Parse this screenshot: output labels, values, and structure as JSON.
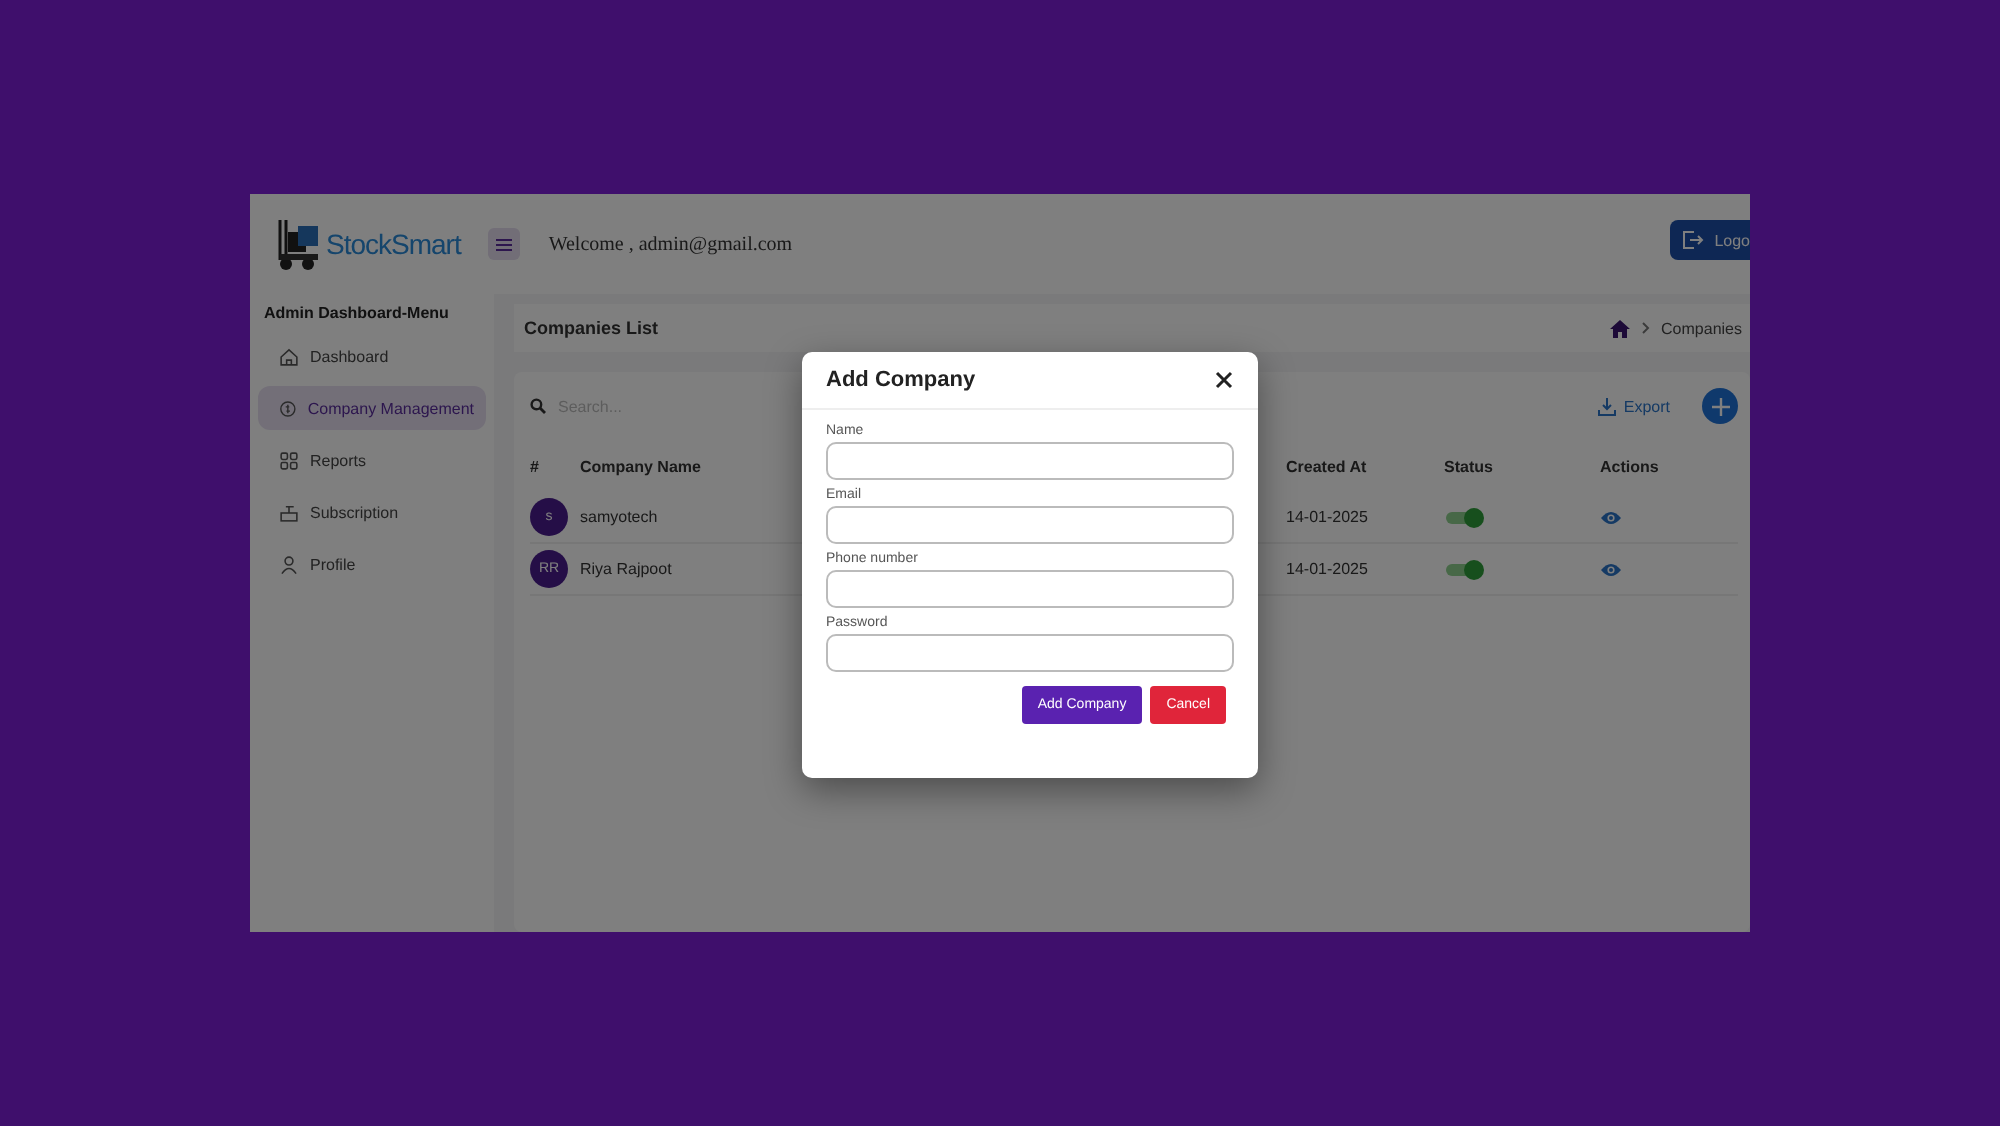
{
  "header": {
    "logo_title": "StockSmart",
    "welcome": "Welcome , admin@gmail.com",
    "logout": "Logo"
  },
  "sidebar": {
    "title": "Admin Dashboard-Menu",
    "items": [
      {
        "label": "Dashboard",
        "selected": false
      },
      {
        "label": "Company Management",
        "selected": true
      },
      {
        "label": "Reports",
        "selected": false
      },
      {
        "label": "Subscription",
        "selected": false
      },
      {
        "label": "Profile",
        "selected": false
      }
    ]
  },
  "page_header": {
    "title": "Companies List",
    "breadcrumb": "Companies"
  },
  "toolbar": {
    "search": {
      "placeholder": "Search..."
    },
    "export": "Export"
  },
  "table": {
    "columns": [
      "#",
      "Company Name",
      "Created At",
      "Status",
      "Actions"
    ],
    "rows": [
      {
        "avatar": "s",
        "name": "samyotech",
        "created_at": "14-01-2025",
        "active": true
      },
      {
        "avatar": "RR",
        "name": "Riya Rajpoot",
        "created_at": "14-01-2025",
        "active": true
      }
    ]
  },
  "modal": {
    "title": "Add Company",
    "fields": [
      {
        "label": "Name"
      },
      {
        "label": "Email"
      },
      {
        "label": "Phone number"
      },
      {
        "label": "Password"
      }
    ],
    "buttons": [
      {
        "label": "Add Company",
        "kind": "primary"
      },
      {
        "label": "Cancel",
        "kind": "danger"
      }
    ]
  }
}
